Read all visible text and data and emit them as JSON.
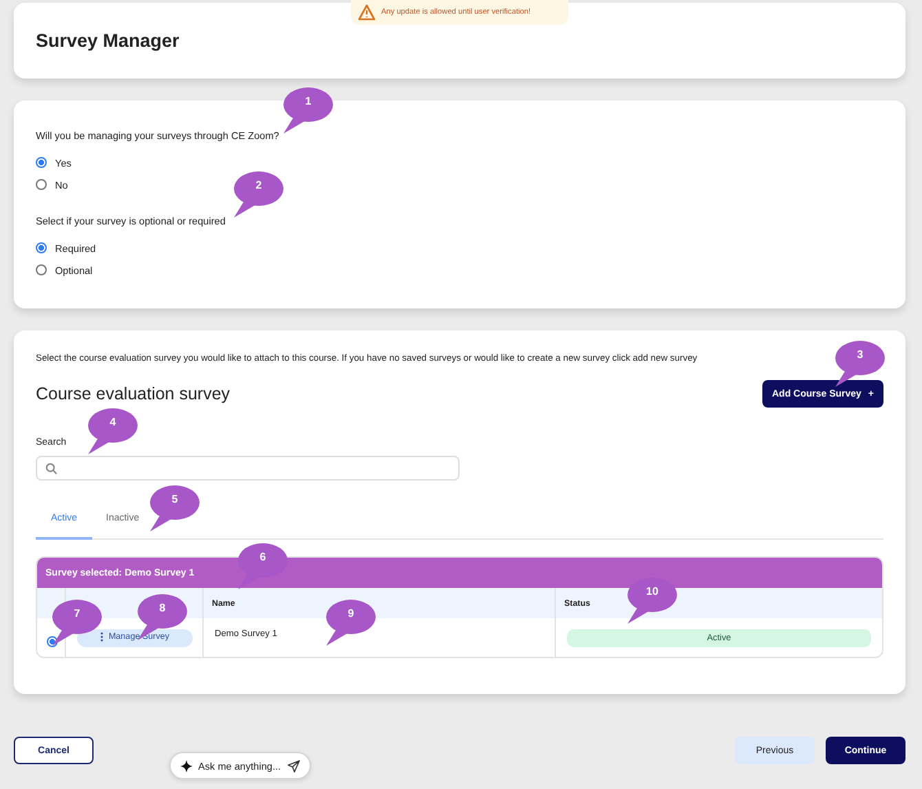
{
  "notice": {
    "text": "Any update is allowed until user verification!"
  },
  "header": {
    "title": "Survey Manager"
  },
  "questions": [
    {
      "label": "Will you be managing your surveys through CE Zoom?",
      "options": [
        {
          "label": "Yes",
          "selected": true
        },
        {
          "label": "No",
          "selected": false
        }
      ]
    },
    {
      "label": "Select if your survey is optional or required",
      "options": [
        {
          "label": "Required",
          "selected": true
        },
        {
          "label": "Optional",
          "selected": false
        }
      ]
    }
  ],
  "survey_section": {
    "intro": "Select the course evaluation survey you would like to attach to this course. If you have no saved surveys or would like to create a new survey click add new survey",
    "title": "Course evaluation survey",
    "add_button": "Add Course Survey",
    "add_icon": "+",
    "search": {
      "label": "Search"
    },
    "tabs": [
      {
        "label": "Active",
        "selected": true
      },
      {
        "label": "Inactive",
        "selected": false
      }
    ],
    "table": {
      "banner": "Survey selected: Demo Survey 1",
      "columns": [
        "Name",
        "Status"
      ],
      "rows": [
        {
          "selected": true,
          "action": "Manage Survey",
          "name": "Demo Survey 1",
          "status": "Active"
        }
      ]
    }
  },
  "footer": {
    "cancel": "Cancel",
    "previous": "Previous",
    "continue": "Continue"
  },
  "assistant": {
    "placeholder": "Ask me anything..."
  },
  "callouts": [
    "1",
    "2",
    "3",
    "4",
    "5",
    "6",
    "7",
    "8",
    "9",
    "10"
  ]
}
